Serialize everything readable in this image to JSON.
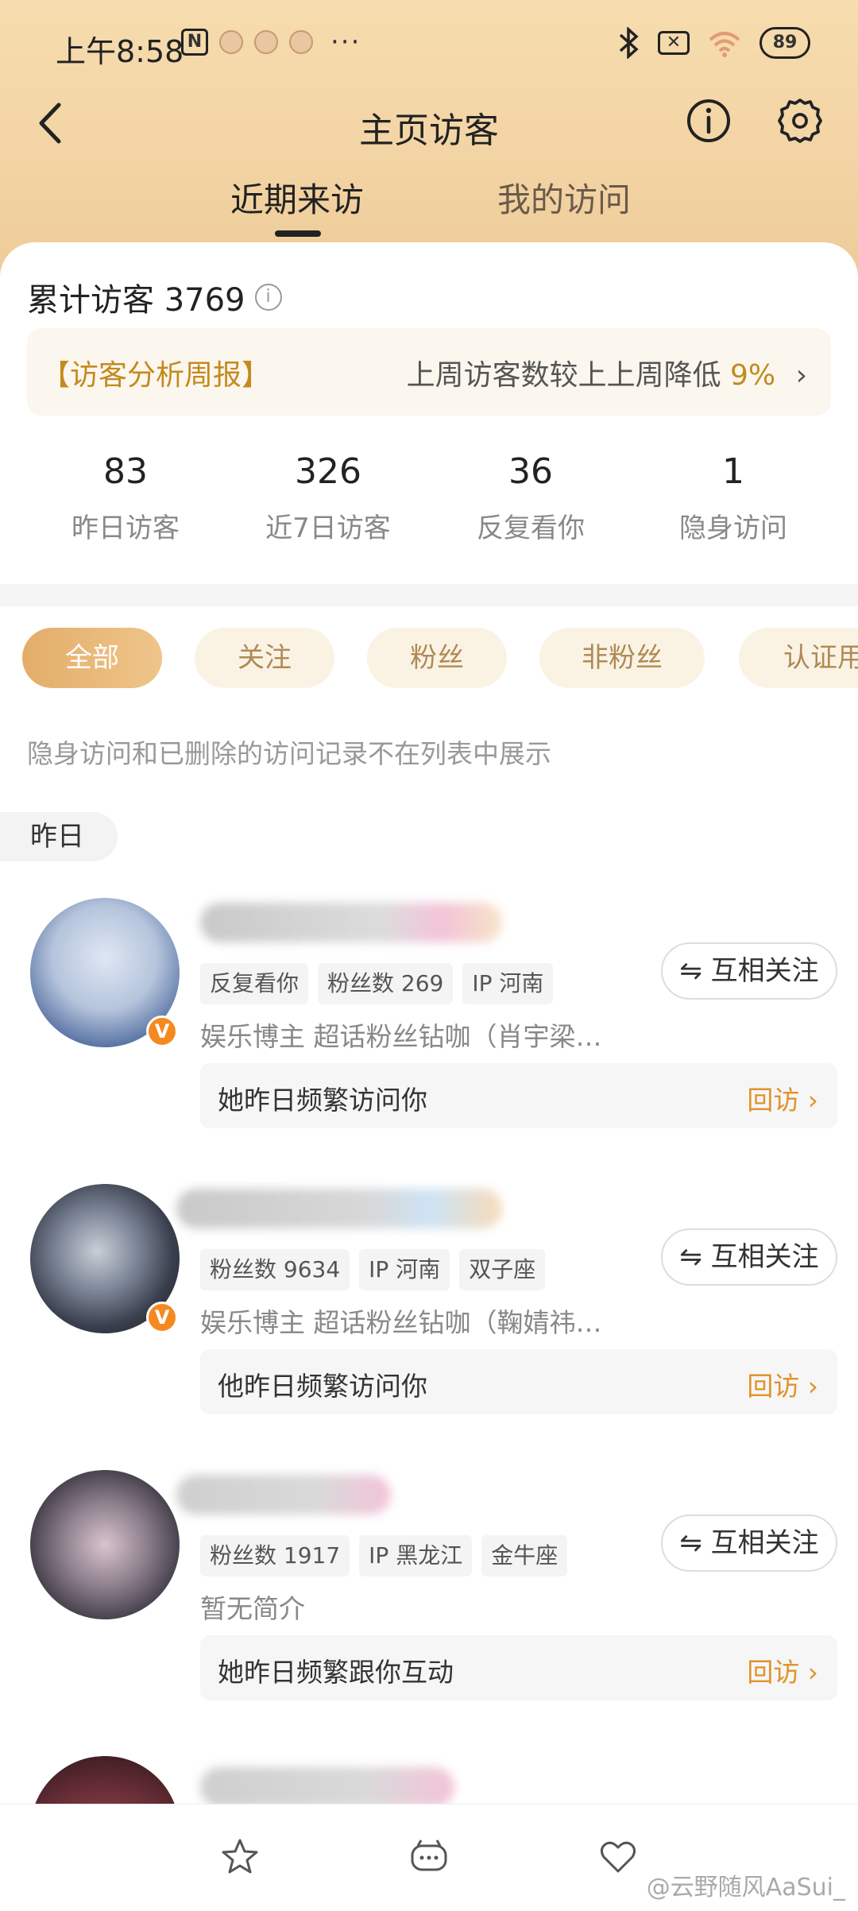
{
  "status_bar": {
    "time": "上午8:58",
    "nfc_label": "N",
    "more": "···",
    "battery": "89"
  },
  "nav": {
    "title": "主页访客"
  },
  "tabs": [
    {
      "label": "近期来访",
      "active": true
    },
    {
      "label": "我的访问",
      "active": false
    }
  ],
  "summary": {
    "total_label": "累计访客 3769",
    "info_glyph": "i"
  },
  "weekly_report": {
    "title": "【访客分析周报】",
    "text": "上周访客数较上上周降低 ",
    "percent": "9%",
    "chevron": "›"
  },
  "stats": [
    {
      "value": "83",
      "label": "昨日访客"
    },
    {
      "value": "326",
      "label": "近7日访客"
    },
    {
      "value": "36",
      "label": "反复看你"
    },
    {
      "value": "1",
      "label": "隐身访问"
    }
  ],
  "filters": [
    {
      "label": "全部",
      "active": true
    },
    {
      "label": "关注",
      "active": false
    },
    {
      "label": "粉丝",
      "active": false
    },
    {
      "label": "非粉丝",
      "active": false
    },
    {
      "label": "认证用",
      "active": false
    }
  ],
  "notice": "隐身访问和已删除的访问记录不在列表中展示",
  "day_label": "昨日",
  "visitors": [
    {
      "tags": [
        "反复看你",
        "粉丝数 269",
        "IP 河南"
      ],
      "bio": "娱乐博主 超话粉丝钻咖（肖宇梁…",
      "follow": "⇋ 互相关注",
      "freq": "她昨日频繁访问你",
      "revisit": "回访 ›",
      "verified_glyph": "V"
    },
    {
      "tags": [
        "粉丝数 9634",
        "IP 河南",
        "双子座"
      ],
      "bio": "娱乐博主 超话粉丝钻咖（鞠婧祎…",
      "follow": "⇋ 互相关注",
      "freq": "他昨日频繁访问你",
      "revisit": "回访 ›",
      "verified_glyph": "V"
    },
    {
      "tags": [
        "粉丝数 1917",
        "IP 黑龙江",
        "金牛座"
      ],
      "bio": "暂无简介",
      "follow": "⇋ 互相关注",
      "freq": "她昨日频繁跟你互动",
      "revisit": "回访 ›"
    }
  ],
  "watermark": "@云野随风AaSui_",
  "colors": {
    "accent": "#e0932a",
    "header_gradient_top": "#f6dcae",
    "chip_active": "#e3ad69"
  }
}
